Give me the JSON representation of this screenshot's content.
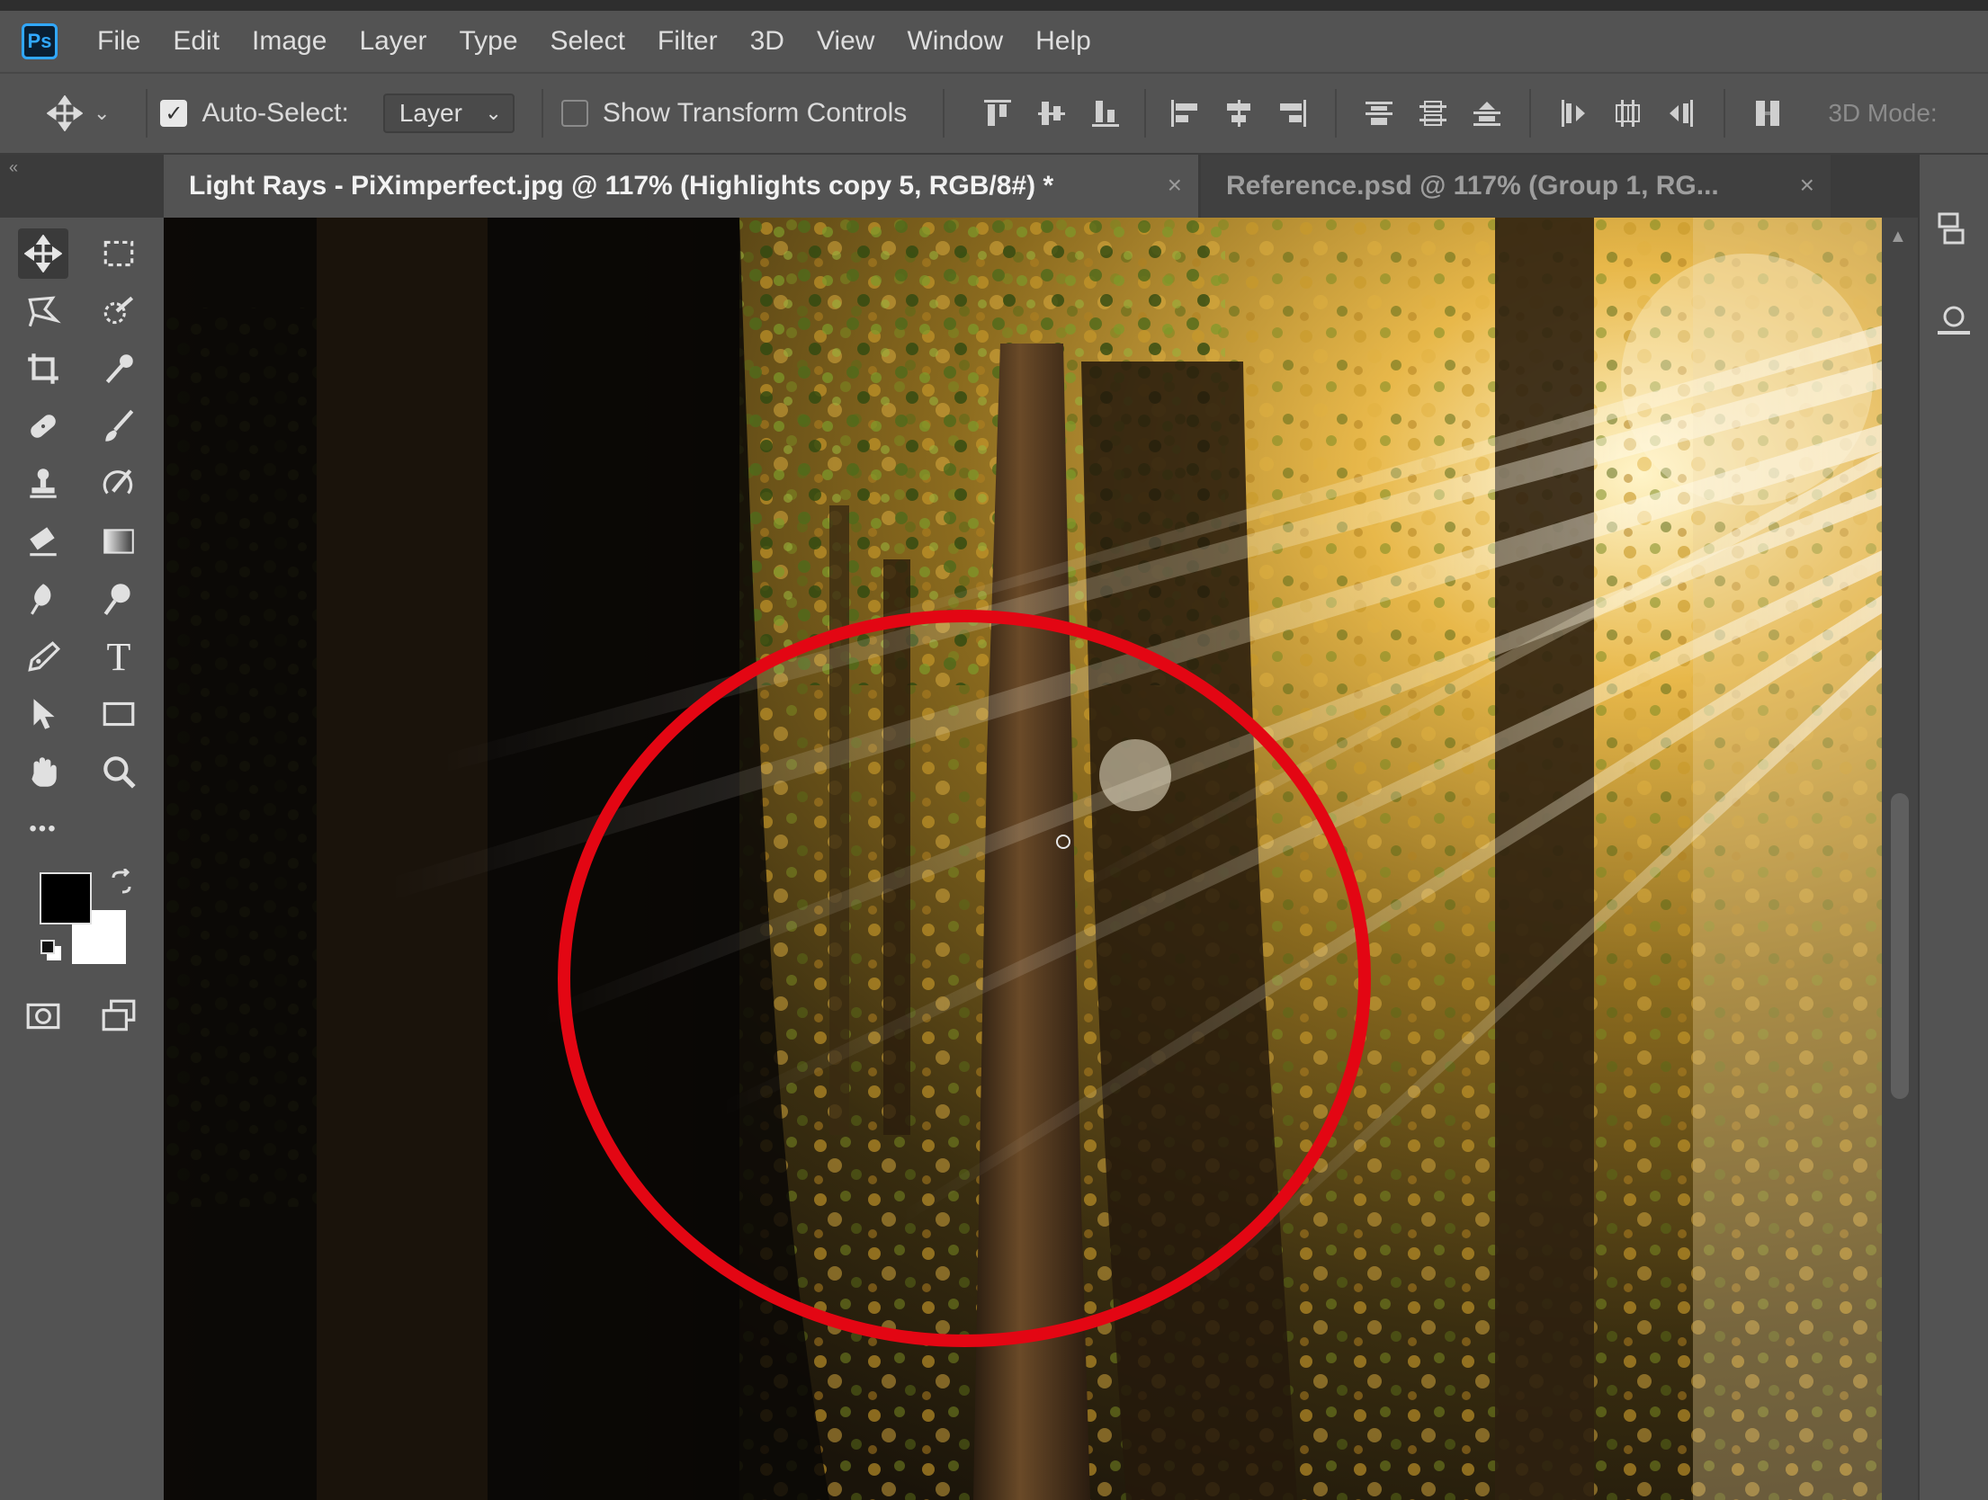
{
  "app": {
    "logo": "Ps"
  },
  "menu": [
    "File",
    "Edit",
    "Image",
    "Layer",
    "Type",
    "Select",
    "Filter",
    "3D",
    "View",
    "Window",
    "Help"
  ],
  "options": {
    "auto_select_label": "Auto-Select:",
    "auto_select_checked": true,
    "auto_select_target": "Layer",
    "show_transform_label": "Show Transform Controls",
    "show_transform_checked": false,
    "three_d_mode_label": "3D Mode:"
  },
  "tabs": [
    {
      "title": "Light Rays - PiXimperfect.jpg @ 117% (Highlights copy 5, RGB/8#) *",
      "active": true
    },
    {
      "title": "Reference.psd @ 117% (Group 1, RG...",
      "active": false
    }
  ],
  "tools": [
    "move-tool",
    "marquee-tool",
    "lasso-tool",
    "quick-selection-tool",
    "crop-tool",
    "eyedropper-tool",
    "healing-brush-tool",
    "brush-tool",
    "clone-stamp-tool",
    "history-brush-tool",
    "eraser-tool",
    "gradient-tool",
    "blur-tool",
    "dodge-tool",
    "pen-tool",
    "type-tool",
    "path-selection-tool",
    "rectangle-tool",
    "hand-tool",
    "zoom-tool",
    "edit-toolbar"
  ],
  "type_tool_glyph": "T",
  "more_tools_glyph": "•••",
  "colors": {
    "foreground": "#000000",
    "background": "#ffffff",
    "annotation": "#e30613",
    "ui_panel": "#535353",
    "tab_strip": "#3b3b3b"
  }
}
